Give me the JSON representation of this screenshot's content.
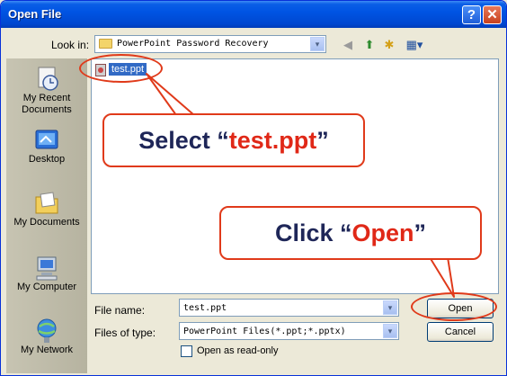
{
  "window": {
    "title": "Open File",
    "help_glyph": "?",
    "close_glyph": "✕"
  },
  "lookin": {
    "label": "Look in:",
    "folder": "PowerPoint Password Recovery",
    "dropdown_glyph": "▾"
  },
  "toolbar": {
    "back_icon": "◀",
    "up_icon": "⬆",
    "new_folder_icon": "✱",
    "views_icon": "▦▾"
  },
  "places": [
    {
      "label": "My Recent Documents",
      "icon": "recent-documents-icon"
    },
    {
      "label": "Desktop",
      "icon": "desktop-icon"
    },
    {
      "label": "My Documents",
      "icon": "my-documents-icon"
    },
    {
      "label": "My Computer",
      "icon": "my-computer-icon"
    },
    {
      "label": "My Network",
      "icon": "my-network-icon"
    }
  ],
  "files": [
    {
      "name": "test.ppt",
      "selected": true
    }
  ],
  "filename": {
    "label": "File name:",
    "value": "test.ppt"
  },
  "filetype": {
    "label": "Files of type:",
    "value": "PowerPoint Files(*.ppt;*.pptx)"
  },
  "readonly": {
    "label": "Open as read-only",
    "checked": false
  },
  "buttons": {
    "open": "Open",
    "cancel": "Cancel"
  },
  "callouts": {
    "select": {
      "prefix": "Select “",
      "highlight": "test.ppt",
      "suffix": "”"
    },
    "click": {
      "prefix": "Click “",
      "highlight": "Open",
      "suffix": "”"
    }
  },
  "colors": {
    "titlebar": "#0054e3",
    "callout_border": "#e03a1a",
    "callout_text": "#1e2658",
    "callout_highlight": "#e02817",
    "selection": "#316ac5"
  }
}
